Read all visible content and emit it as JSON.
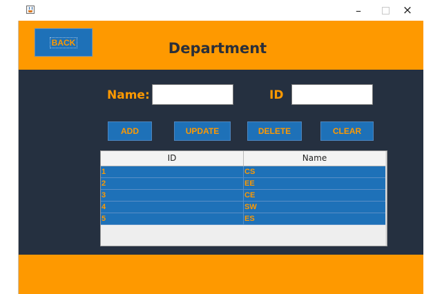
{
  "window": {
    "minimize_glyph": "–",
    "close_glyph": "×",
    "icons": [
      "java-app-icon",
      "minimize-icon",
      "maximize-icon",
      "close-icon"
    ]
  },
  "header": {
    "back_label": "BACK",
    "title": "Department"
  },
  "form": {
    "name_label": "Name:",
    "name_value": "",
    "id_label": "ID",
    "id_value": ""
  },
  "actions": {
    "add": "ADD",
    "update": "UPDATE",
    "delete": "DELETE",
    "clear": "CLEAR"
  },
  "table": {
    "columns": [
      "ID",
      "Name"
    ],
    "rows": [
      {
        "id": "1",
        "name": "CS"
      },
      {
        "id": "2",
        "name": "EE"
      },
      {
        "id": "3",
        "name": "CE"
      },
      {
        "id": "4",
        "name": "SW"
      },
      {
        "id": "5",
        "name": "ES"
      }
    ]
  },
  "colors": {
    "accent_orange": "#fe9900",
    "button_blue": "#1e71b8",
    "panel_dark": "#253040"
  }
}
